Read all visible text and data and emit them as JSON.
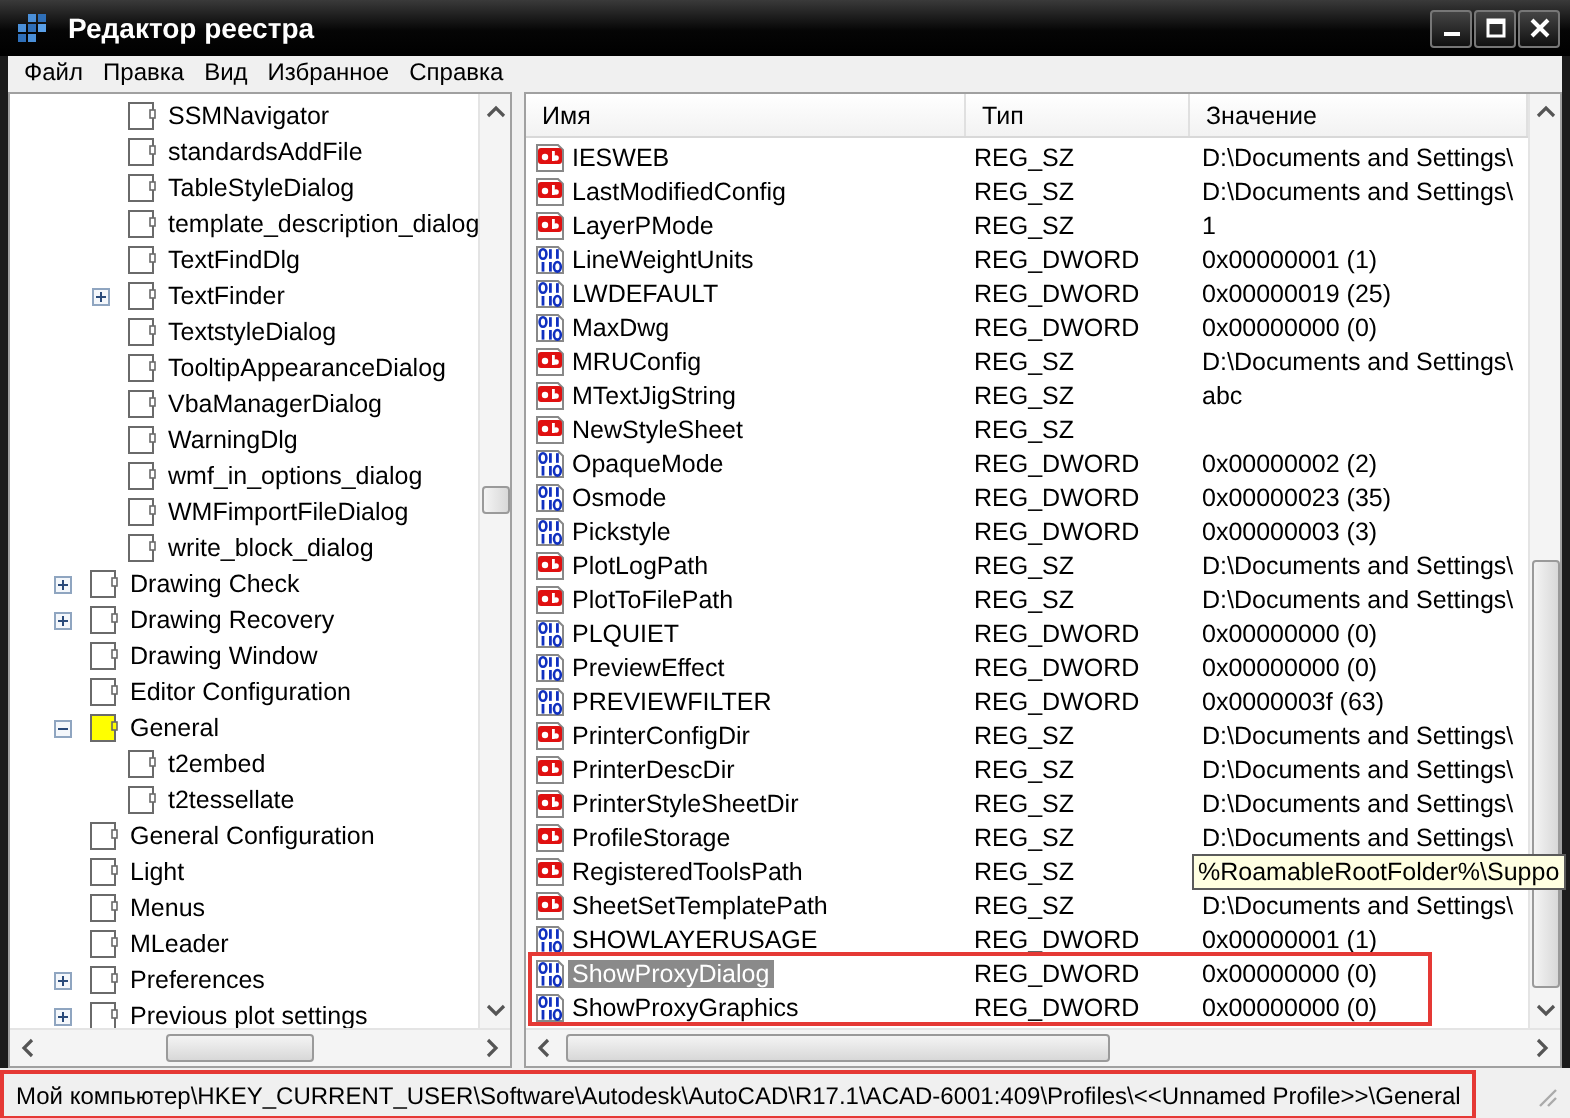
{
  "window": {
    "title": "Редактор реестра"
  },
  "menu": [
    "Файл",
    "Правка",
    "Вид",
    "Избранное",
    "Справка"
  ],
  "tree": [
    {
      "children": [
        {
          "label": "SSMNavigator",
          "selected": false
        },
        {
          "label": "standardsAddFile",
          "selected": false
        },
        {
          "label": "TableStyleDialog",
          "selected": false
        },
        {
          "label": "template_description_dialog",
          "selected": false
        },
        {
          "label": "TextFindDlg",
          "selected": false
        },
        {
          "label": "TextFinder",
          "expanded": false,
          "selected": false
        },
        {
          "label": "TextstyleDialog",
          "selected": false
        },
        {
          "label": "TooltipAppearanceDialog",
          "selected": false
        },
        {
          "label": "VbaManagerDialog",
          "selected": false
        },
        {
          "label": "WarningDlg",
          "selected": false
        },
        {
          "label": "wmf_in_options_dialog",
          "selected": false
        },
        {
          "label": "WMFimportFileDialog",
          "selected": false
        },
        {
          "label": "write_block_dialog",
          "selected": false
        }
      ]
    },
    {
      "label": "Drawing Check",
      "expanded": false,
      "selected": false
    },
    {
      "label": "Drawing Recovery",
      "expanded": false,
      "selected": false
    },
    {
      "label": "Drawing Window",
      "selected": false
    },
    {
      "label": "Editor Configuration",
      "selected": false
    },
    {
      "label": "General",
      "expanded": true,
      "selected": true,
      "children": [
        {
          "label": "t2embed",
          "selected": false
        },
        {
          "label": "t2tessellate",
          "selected": false
        }
      ]
    },
    {
      "label": "General Configuration",
      "selected": false
    },
    {
      "label": "Light",
      "selected": false
    },
    {
      "label": "Menus",
      "selected": false
    },
    {
      "label": "MLeader",
      "selected": false
    },
    {
      "label": "Preferences",
      "expanded": false,
      "selected": false
    },
    {
      "label": "Previous plot settings",
      "expanded": false,
      "selected": false
    }
  ],
  "table": {
    "columns": [
      "Имя",
      "Тип",
      "Значение"
    ],
    "rows": [
      {
        "kind": "sz",
        "name": "IESWEB",
        "type": "REG_SZ",
        "value": "D:\\Documents and Settings\\",
        "selected": false,
        "marked": false
      },
      {
        "kind": "sz",
        "name": "LastModifiedConfig",
        "type": "REG_SZ",
        "value": "D:\\Documents and Settings\\",
        "selected": false,
        "marked": false
      },
      {
        "kind": "sz",
        "name": "LayerPMode",
        "type": "REG_SZ",
        "value": "1",
        "selected": false,
        "marked": false
      },
      {
        "kind": "dword",
        "name": "LineWeightUnits",
        "type": "REG_DWORD",
        "value": "0x00000001 (1)",
        "selected": false,
        "marked": false
      },
      {
        "kind": "dword",
        "name": "LWDEFAULT",
        "type": "REG_DWORD",
        "value": "0x00000019 (25)",
        "selected": false,
        "marked": false
      },
      {
        "kind": "dword",
        "name": "MaxDwg",
        "type": "REG_DWORD",
        "value": "0x00000000 (0)",
        "selected": false,
        "marked": false
      },
      {
        "kind": "sz",
        "name": "MRUConfig",
        "type": "REG_SZ",
        "value": "D:\\Documents and Settings\\",
        "selected": false,
        "marked": false
      },
      {
        "kind": "sz",
        "name": "MTextJigString",
        "type": "REG_SZ",
        "value": "abc",
        "selected": false,
        "marked": false
      },
      {
        "kind": "sz",
        "name": "NewStyleSheet",
        "type": "REG_SZ",
        "selected": false,
        "marked": false
      },
      {
        "kind": "dword",
        "name": "OpaqueMode",
        "type": "REG_DWORD",
        "value": "0x00000002 (2)",
        "selected": false,
        "marked": false
      },
      {
        "kind": "dword",
        "name": "Osmode",
        "type": "REG_DWORD",
        "value": "0x00000023 (35)",
        "selected": false,
        "marked": false
      },
      {
        "kind": "dword",
        "name": "Pickstyle",
        "type": "REG_DWORD",
        "value": "0x00000003 (3)",
        "selected": false,
        "marked": false
      },
      {
        "kind": "sz",
        "name": "PlotLogPath",
        "type": "REG_SZ",
        "value": "D:\\Documents and Settings\\",
        "selected": false,
        "marked": false
      },
      {
        "kind": "sz",
        "name": "PlotToFilePath",
        "type": "REG_SZ",
        "value": "D:\\Documents and Settings\\",
        "selected": false,
        "marked": false
      },
      {
        "kind": "dword",
        "name": "PLQUIET",
        "type": "REG_DWORD",
        "value": "0x00000000 (0)",
        "selected": false,
        "marked": false
      },
      {
        "kind": "dword",
        "name": "PreviewEffect",
        "type": "REG_DWORD",
        "value": "0x00000000 (0)",
        "selected": false,
        "marked": false
      },
      {
        "kind": "dword",
        "name": "PREVIEWFILTER",
        "type": "REG_DWORD",
        "value": "0x0000003f (63)",
        "selected": false,
        "marked": false
      },
      {
        "kind": "sz",
        "name": "PrinterConfigDir",
        "type": "REG_SZ",
        "value": "D:\\Documents and Settings\\",
        "selected": false,
        "marked": false
      },
      {
        "kind": "sz",
        "name": "PrinterDescDir",
        "type": "REG_SZ",
        "value": "D:\\Documents and Settings\\",
        "selected": false,
        "marked": false
      },
      {
        "kind": "sz",
        "name": "PrinterStyleSheetDir",
        "type": "REG_SZ",
        "value": "D:\\Documents and Settings\\",
        "selected": false,
        "marked": false
      },
      {
        "kind": "sz",
        "name": "ProfileStorage",
        "type": "REG_SZ",
        "value": "D:\\Documents and Settings\\",
        "selected": false,
        "marked": false
      },
      {
        "kind": "sz",
        "name": "RegisteredToolsPath",
        "type": "REG_SZ",
        "tooltip": "%RoamableRootFolder%\\Suppo",
        "selected": false,
        "marked": false
      },
      {
        "kind": "sz",
        "name": "SheetSetTemplatePath",
        "type": "REG_SZ",
        "value": "D:\\Documents and Settings\\",
        "selected": false,
        "marked": false
      },
      {
        "kind": "dword",
        "name": "SHOWLAYERUSAGE",
        "type": "REG_DWORD",
        "value": "0x00000001 (1)",
        "selected": false,
        "marked": false
      },
      {
        "kind": "dword",
        "name": "ShowProxyDialog",
        "type": "REG_DWORD",
        "value": "0x00000000 (0)",
        "selected": true,
        "marked": true
      },
      {
        "kind": "dword",
        "name": "ShowProxyGraphics",
        "type": "REG_DWORD",
        "value": "0x00000000 (0)",
        "selected": false,
        "marked": true
      }
    ]
  },
  "status_bar": {
    "text": "Мой компьютер\\HKEY_CURRENT_USER\\Software\\Autodesk\\AutoCAD\\R17.1\\ACAD-6001:409\\Profiles\\<<Unnamed Profile>>\\General",
    "marked": true
  }
}
